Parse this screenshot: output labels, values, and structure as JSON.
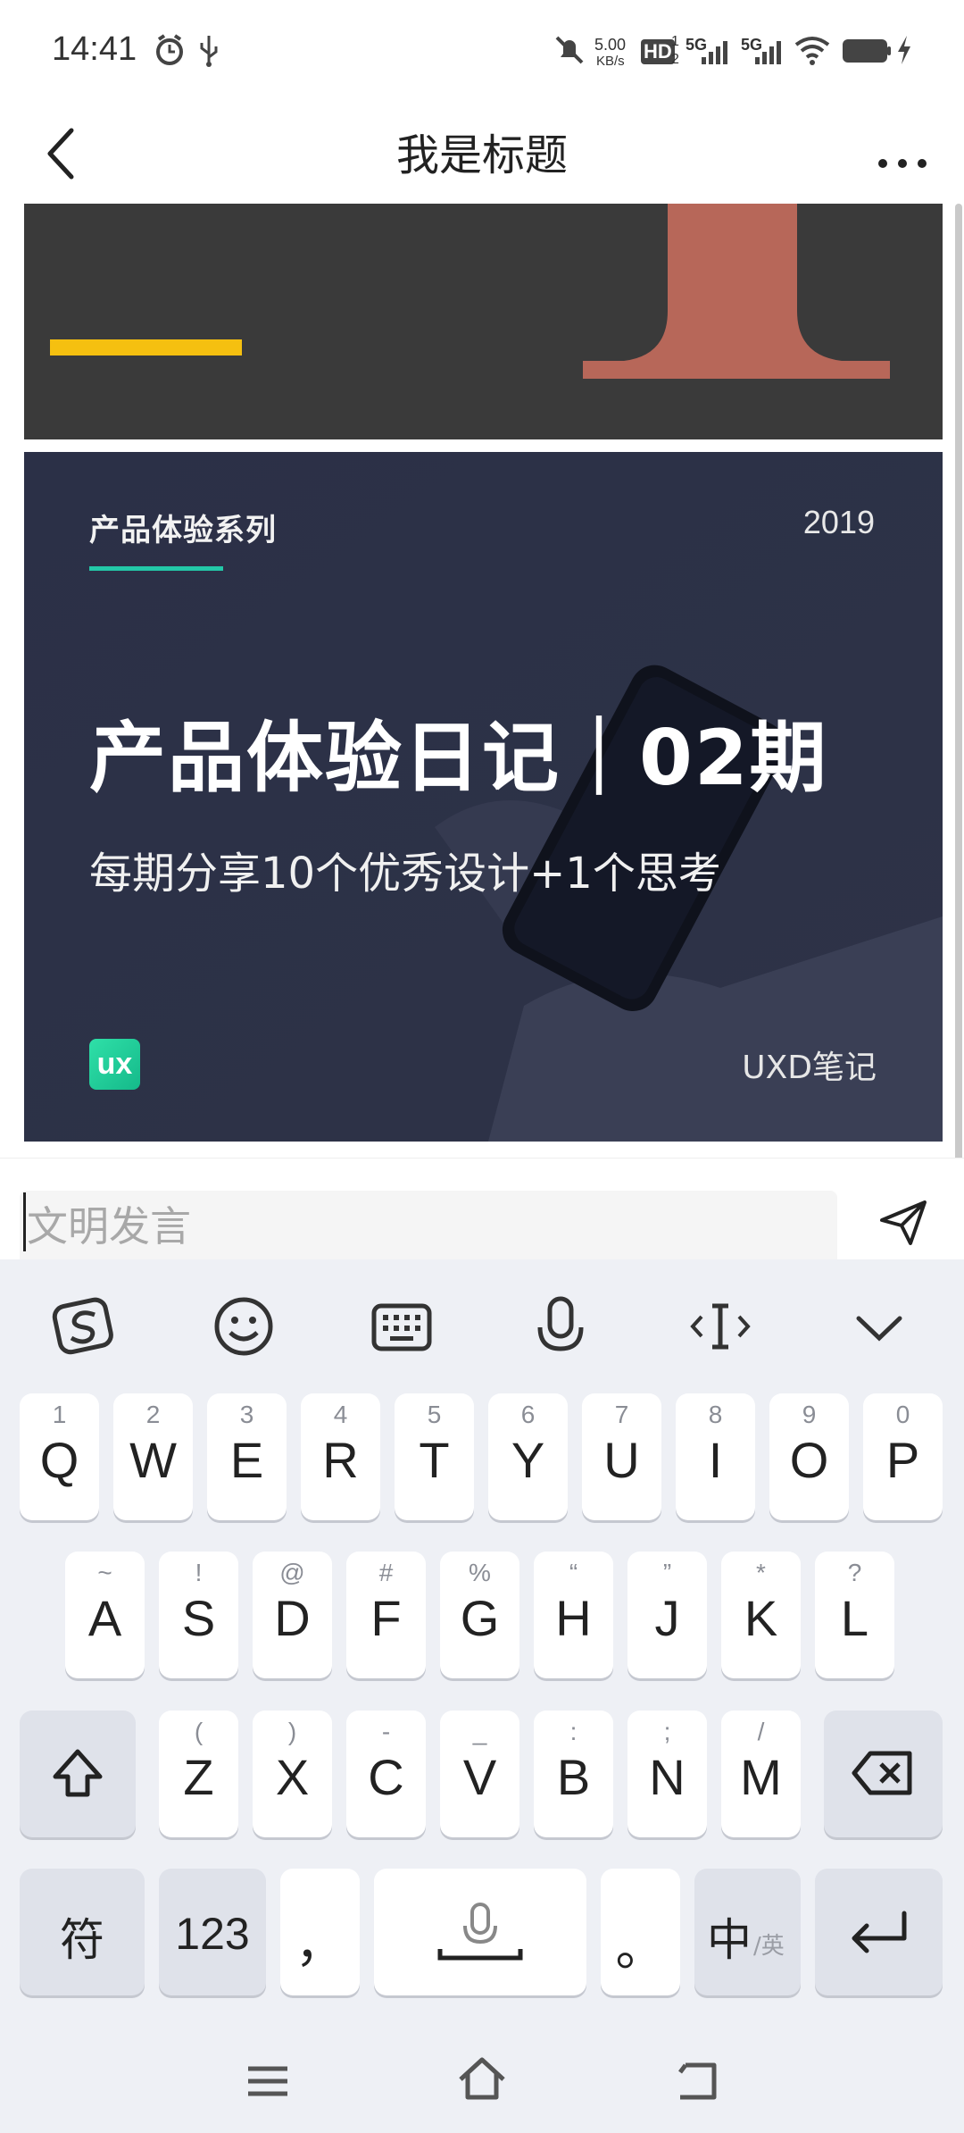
{
  "status_bar": {
    "time": "14:41",
    "net_speed_value": "5.00",
    "net_speed_unit": "KB/s",
    "hd_label": "HD",
    "sim1": "1",
    "sim2": "2",
    "network_1": "5G",
    "network_2": "5G"
  },
  "nav": {
    "title": "我是标题"
  },
  "banner": {
    "series": "产品体验系列",
    "year": "2019",
    "title": "产品体验日记｜02期",
    "subtitle": "每期分享10个优秀设计+1个思考",
    "logo_text": "ux",
    "brand": "UXD笔记",
    "accent_color": "#23c8a8"
  },
  "comment": {
    "placeholder": "文明发言"
  },
  "keyboard": {
    "row1": [
      {
        "key": "Q",
        "hint": "1"
      },
      {
        "key": "W",
        "hint": "2"
      },
      {
        "key": "E",
        "hint": "3"
      },
      {
        "key": "R",
        "hint": "4"
      },
      {
        "key": "T",
        "hint": "5"
      },
      {
        "key": "Y",
        "hint": "6"
      },
      {
        "key": "U",
        "hint": "7"
      },
      {
        "key": "I",
        "hint": "8"
      },
      {
        "key": "O",
        "hint": "9"
      },
      {
        "key": "P",
        "hint": "0"
      }
    ],
    "row2": [
      {
        "key": "A",
        "hint": "~"
      },
      {
        "key": "S",
        "hint": "!"
      },
      {
        "key": "D",
        "hint": "@"
      },
      {
        "key": "F",
        "hint": "#"
      },
      {
        "key": "G",
        "hint": "%"
      },
      {
        "key": "H",
        "hint": "“"
      },
      {
        "key": "J",
        "hint": "”"
      },
      {
        "key": "K",
        "hint": "*"
      },
      {
        "key": "L",
        "hint": "?"
      }
    ],
    "row3": [
      {
        "key": "Z",
        "hint": "("
      },
      {
        "key": "X",
        "hint": ")"
      },
      {
        "key": "C",
        "hint": "-"
      },
      {
        "key": "V",
        "hint": "_"
      },
      {
        "key": "B",
        "hint": ":"
      },
      {
        "key": "N",
        "hint": ";"
      },
      {
        "key": "M",
        "hint": "/"
      }
    ],
    "symbol_key": "符",
    "num_key": "123",
    "comma_key": "，",
    "period_key": "。",
    "lang_key_main": "中",
    "lang_key_sub": "/英"
  }
}
